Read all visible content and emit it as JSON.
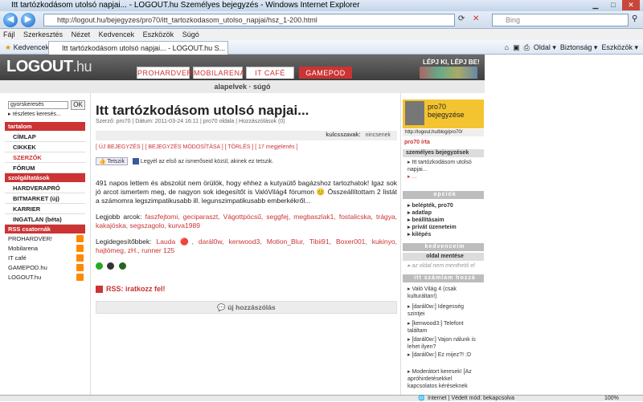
{
  "window": {
    "title": "Itt tartózkodásom utolsó napjai... - LOGOUT.hu Személyes bejegyzés - Windows Internet Explorer"
  },
  "browser": {
    "url": "http://logout.hu/bejegyzes/pro70/itt_tartozkodasom_utolso_napjai/hsz_1-200.html",
    "search_placeholder": "Bing",
    "menu": [
      "Fájl",
      "Szerkesztés",
      "Nézet",
      "Kedvencek",
      "Eszközök",
      "Súgó"
    ],
    "favorites": "Kedvencek",
    "tab_title": "Itt tartózkodásom utolsó napjai... - LOGOUT.hu S...",
    "tools": [
      "Oldal",
      "Biztonság",
      "Eszközök"
    ]
  },
  "site": {
    "logo_main": "LOGOUT",
    "logo_suffix": ".hu",
    "tabs": [
      "PROHARDVER!",
      "MOBILARENA",
      "IT CAFÉ",
      "GAMEPOD"
    ],
    "slogan": "LÉPJ KI, LÉPJ BE!",
    "subnav": [
      "alapelvek",
      "súgó"
    ]
  },
  "left": {
    "search_value": "gyorskeresés",
    "ok": "OK",
    "advanced": "részletes keresés...",
    "section1": "tartalom",
    "items1": [
      "CÍMLAP",
      "CIKKEK",
      "SZERZŐK",
      "FÓRUM"
    ],
    "section2": "szolgáltatások",
    "items2": [
      "HARDVERAPRÓ",
      "BITMARKET (új)",
      "KARRIER",
      "INGATLAN (béta)"
    ],
    "section3": "RSS csatornák",
    "rss": [
      "PROHARDVER!",
      "Mobilarena",
      "IT café",
      "GAMEPOD.hu",
      "LOGOUT.hu"
    ]
  },
  "article": {
    "title": "Itt tartózkodásom utolsó napjai...",
    "meta": "Szerző: pro70 | Dátum: 2011-03-24 16:11 | pro70 oldala | Hozzászólások (0)",
    "keywords_label": "kulcsszavak:",
    "keywords_value": "nincsenek",
    "actions": "[ ÚJ BEJEGYZÉS ]  [ BEJEGYZÉS MÓDOSÍTÁSA ]  [ TÖRLÉS ]  [ 17 megjelenés ]",
    "like_button": "Tetszik",
    "like_text": "Legyél az első az ismerőseid közül, akinek ez tetszik.",
    "para1": "491 napos lettem és abszolút nem örülök, hogy ehhez a kutyaütő bagázshoz tartozhatok! Igaz sok jó arcot ismertem meg, de nagyon sok idegesítőt is ValóVilág4 fórumon 😊 Összeállítottam 2 listát a számomra legszimpatikusabb ill. legunszimpatikusabb emberkékről...",
    "para2_label": "Legjobb arcok:",
    "para2": "faszfejtomi, geciparaszt, Vágottpöcsű, seggfej, megbaszlak1, fostalicska, trágya, kakajóska, segszagolo, kurva1989",
    "para3_label": "Legidegesítőbbek:",
    "para3": "Lauda 🔴, darál0w, kenwood3, Motion_Blur, Tibii91, Boxer001, kukinyo, hajtómeg, zH., runner 125",
    "rss": "RSS: iratkozz fel!",
    "new_comment": "új hozzászólás"
  },
  "right": {
    "blog_title": "pro70 bejegyzése",
    "blog_url": "http://logout.hu/blog/pro70/",
    "writes": "pro70 írta",
    "personal": "személyes bejegyzések",
    "entry": "Itt tartózkodásom utolsó napjai...",
    "more": "...",
    "options_head": "opciók",
    "options": [
      "belépték, pro70",
      "adatlap",
      "beállításaim",
      "privát üzeneteim",
      "kilépés"
    ],
    "fav_head": "kedvenceim",
    "save_head": "oldal mentése",
    "save_text": "az oldal nem menthető el",
    "threads_head": "itt számlam hozzá",
    "threads": [
      "Való Világ 4 (csak kulturáltan!)",
      "[darál0w:] Idegesség szintjei",
      "[kenwood3:] Telefont találtam",
      "[darál0w:] Vajon nálunk is lehet ilyen?",
      "[darál0w:] Ez mijez?! :D",
      "Moderátort keresek! [Az apróhirdetésekkel kapcsolatos kéréseknek"
    ]
  },
  "status": {
    "text": "Internet | Védett mód: bekapcsolva",
    "zoom": "100%"
  }
}
